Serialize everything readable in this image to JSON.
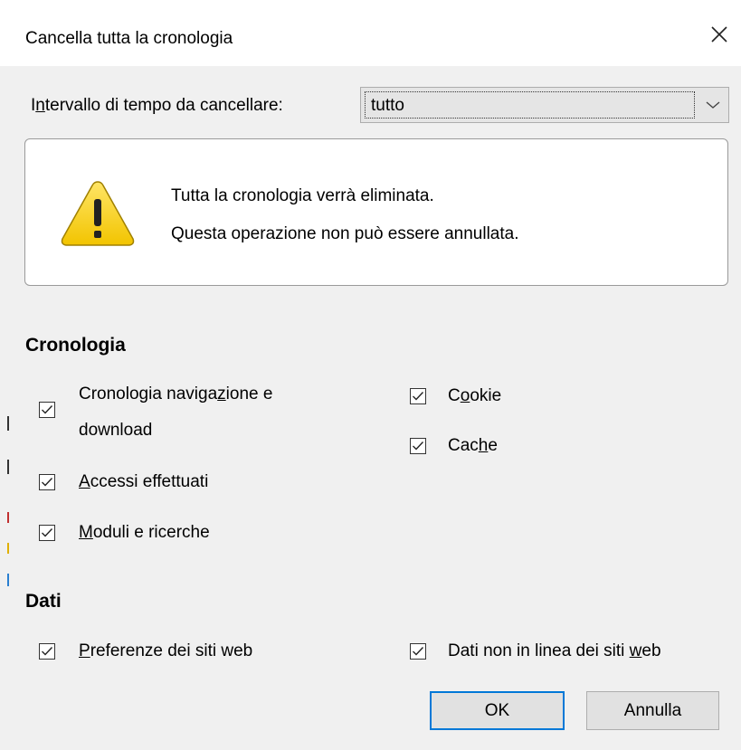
{
  "window": {
    "title": "Cancella tutta la cronologia",
    "close_glyph": "✕"
  },
  "range": {
    "label_pre": "I",
    "label_underline": "n",
    "label_post": "tervallo di tempo da cancellare:",
    "selected": "tutto"
  },
  "warning": {
    "line1": "Tutta la cronologia verrà eliminata.",
    "line2": "Questa operazione non può essere annullata."
  },
  "history_section": {
    "title": "Cronologia",
    "items": [
      {
        "pre": "Cronologia naviga",
        "ul": "z",
        "post": "ione e",
        "line2": "download",
        "checked": true
      },
      {
        "pre": "",
        "ul": "A",
        "post": "ccessi effettuati",
        "checked": true
      },
      {
        "pre": "",
        "ul": "M",
        "post": "oduli e ricerche",
        "checked": true
      },
      {
        "pre": "C",
        "ul": "o",
        "post": "okie",
        "checked": true
      },
      {
        "pre": "Cac",
        "ul": "h",
        "post": "e",
        "checked": true
      }
    ]
  },
  "data_section": {
    "title": "Dati",
    "items": [
      {
        "pre": "",
        "ul": "P",
        "post": "referenze dei siti web",
        "checked": true
      },
      {
        "pre": "Dati non in linea dei siti ",
        "ul": "w",
        "post": "eb",
        "checked": true
      }
    ]
  },
  "buttons": {
    "ok": "OK",
    "cancel": "Annulla"
  },
  "colors": {
    "accent": "#0078d7",
    "warning_yellow": "#f5d21c"
  },
  "icons": [
    "close-icon",
    "chevron-down-icon",
    "warning-icon",
    "checkmark-icon"
  ]
}
